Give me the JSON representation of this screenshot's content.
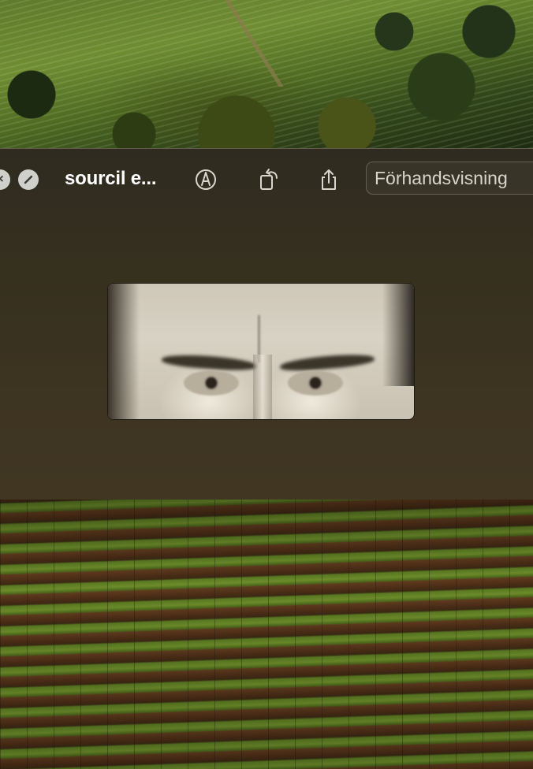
{
  "window": {
    "title": "sourcil e...",
    "search_placeholder": "Förhandsvisning"
  },
  "toolbar": {
    "buttons": [
      {
        "name": "markup",
        "icon": "markup-pen-icon"
      },
      {
        "name": "rotate",
        "icon": "rotate-left-icon"
      },
      {
        "name": "share",
        "icon": "share-icon"
      }
    ]
  },
  "traffic_lights": {
    "close_icon": "close-icon",
    "minimize_icon": "minimize-icon"
  },
  "colors": {
    "window_bg": "#36301f",
    "title_text": "#ffffff",
    "toolbar_icon": "#d9d6cf"
  }
}
